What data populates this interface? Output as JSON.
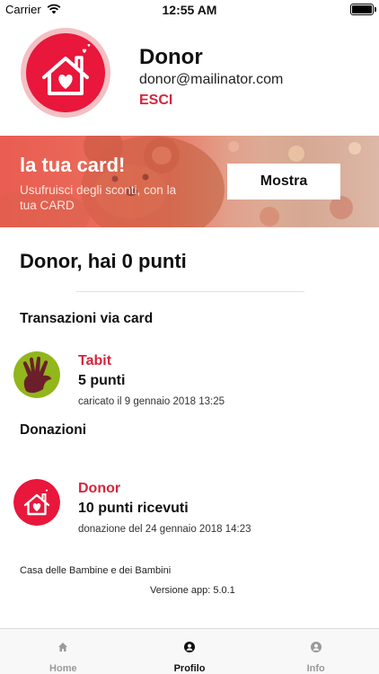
{
  "status_bar": {
    "carrier": "Carrier",
    "time": "12:55 AM",
    "battery_level": 0.9
  },
  "profile": {
    "name": "Donor",
    "email": "donor@mailinator.com",
    "logout_label": "ESCI",
    "logo_icon": "house-hearts-logo"
  },
  "card_banner": {
    "title": "la tua card!",
    "subtitle": "Usufruisci degli sconti, con la tua CARD",
    "button_label": "Mostra"
  },
  "points": {
    "title": "Donor, hai 0 punti"
  },
  "transactions": {
    "section_title": "Transazioni via card",
    "items": [
      {
        "name": "Tabit",
        "points": "5 punti",
        "date": "caricato il 9 gennaio 2018 13:25",
        "icon": "tabit-hand-logo"
      }
    ]
  },
  "donations": {
    "section_title": "Donazioni",
    "items": [
      {
        "name": "Donor",
        "points": "10 punti ricevuti",
        "date": "donazione del 24 gennaio 2018 14:23",
        "icon": "house-hearts-logo"
      }
    ]
  },
  "footer": {
    "organization": "Casa delle Bambine e dei Bambini",
    "version": "Versione app: 5.0.1"
  },
  "tab_bar": {
    "tabs": [
      {
        "label": "Home",
        "icon": "home-icon",
        "active": false
      },
      {
        "label": "Profilo",
        "icon": "user-icon",
        "active": true
      },
      {
        "label": "Info",
        "icon": "info-icon",
        "active": false
      }
    ]
  },
  "colors": {
    "accent": "#d6253a",
    "banner": "#e26a55",
    "tab_active": "#111111",
    "tab_inactive": "#9a9a9a"
  }
}
